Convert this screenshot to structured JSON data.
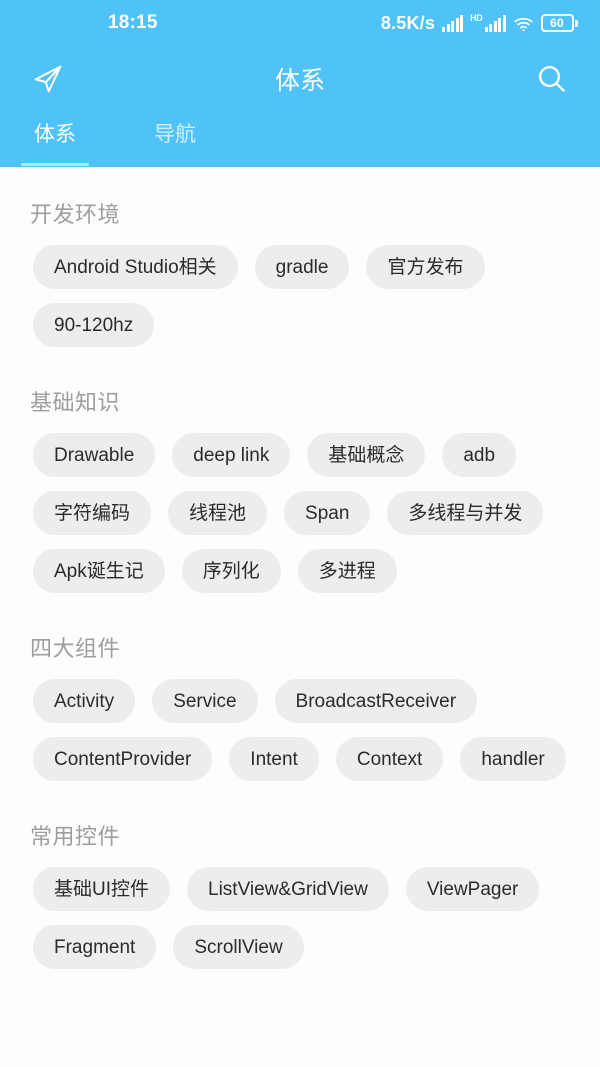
{
  "status_bar": {
    "time": "18:15",
    "net_speed": "8.5K/s",
    "hd_label": "HD",
    "battery_level": "60",
    "icons": [
      "signal-bars-icon",
      "hd-icon",
      "wifi-icon",
      "battery-icon"
    ]
  },
  "app_bar": {
    "title": "体系",
    "left_icon": "send-icon",
    "right_icon": "search-icon"
  },
  "tabs": [
    {
      "label": "体系",
      "active": true
    },
    {
      "label": "导航",
      "active": false
    }
  ],
  "colors": {
    "accent": "#4fc3f7",
    "chip_bg": "#ededed",
    "chip_text": "#2b2b2b",
    "section_title": "#9e9e9e",
    "page_bg": "#fdfdfd"
  },
  "sections": [
    {
      "title": "开发环境",
      "chips": [
        "Android Studio相关",
        "gradle",
        "官方发布",
        "90-120hz"
      ]
    },
    {
      "title": "基础知识",
      "chips": [
        "Drawable",
        "deep link",
        "基础概念",
        "adb",
        "字符编码",
        "线程池",
        "Span",
        "多线程与并发",
        "Apk诞生记",
        "序列化",
        "多进程"
      ]
    },
    {
      "title": "四大组件",
      "chips": [
        "Activity",
        "Service",
        "BroadcastReceiver",
        "ContentProvider",
        "Intent",
        "Context",
        "handler"
      ]
    },
    {
      "title": "常用控件",
      "chips": [
        "基础UI控件",
        "ListView&GridView",
        "ViewPager",
        "Fragment",
        "ScrollView"
      ]
    }
  ]
}
